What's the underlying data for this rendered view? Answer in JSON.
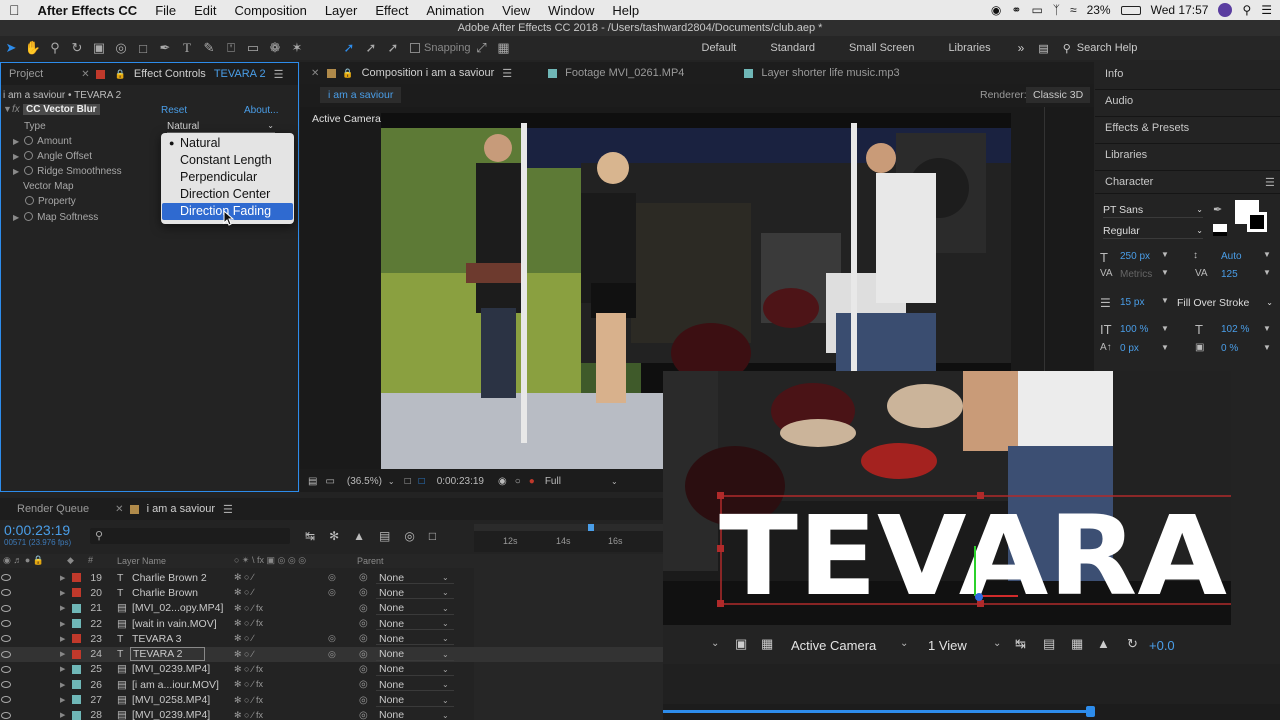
{
  "menubar": {
    "items": [
      "After Effects CC",
      "File",
      "Edit",
      "Composition",
      "Layer",
      "Effect",
      "Animation",
      "View",
      "Window",
      "Help"
    ],
    "battery": "23%",
    "clock": "Wed 17:57"
  },
  "titlebar": {
    "title": "Adobe After Effects CC 2018 - /Users/tashward2804/Documents/club.aep *"
  },
  "toolbar": {
    "snapping": "Snapping",
    "workspaces": [
      "Default",
      "Standard",
      "Small Screen",
      "Libraries"
    ],
    "search": "Search Help"
  },
  "effect_panel": {
    "tab_project": "Project",
    "tab_effect_prefix": "Effect Controls ",
    "tab_effect_layer": "TEVARA 2",
    "breadcrumb": "i am a saviour • TEVARA 2",
    "effect_name": "CC Vector Blur",
    "reset": "Reset",
    "about": "About...",
    "type_label": "Type",
    "type_value": "Natural",
    "props": [
      "Amount",
      "Angle Offset",
      "Ridge Smoothness"
    ],
    "vector_map": "Vector Map",
    "property": "Property",
    "map_softness": "Map Softness",
    "type_options": [
      "Natural",
      "Constant Length",
      "Perpendicular",
      "Direction Center",
      "Direction Fading"
    ],
    "highlighted_option": "Direction Fading"
  },
  "comp_panel": {
    "tabs": [
      "Composition i am a saviour",
      "Footage MVI_0261.MP4",
      "Layer shorter life music.mp3"
    ],
    "comp_button": "i am a saviour",
    "renderer_label": "Renderer:",
    "renderer_value": "Classic 3D",
    "active_camera": "Active Camera",
    "zoom": "(36.5%)",
    "timecode": "0:00:23:19",
    "resolution": "Full"
  },
  "right_panel": {
    "sections": [
      "Info",
      "Audio",
      "Effects & Presets",
      "Libraries",
      "Character"
    ],
    "font": "PT Sans",
    "style": "Regular",
    "font_size": "250 px",
    "leading": "Auto",
    "kerning": "Metrics",
    "tracking": "125",
    "stroke_width": "15 px",
    "stroke_type": "Fill Over Stroke",
    "vscale": "100 %",
    "hscale": "102 %",
    "baseline": "0 px",
    "tsume": "0 %"
  },
  "timeline": {
    "tab_render": "Render Queue",
    "tab_comp": "i am a saviour",
    "timecode": "0:00:23:19",
    "frames": "00571 (23.976 fps)",
    "ruler": [
      "12s",
      "14s",
      "16s"
    ],
    "col_layer_name": "Layer Name",
    "col_parent": "Parent",
    "layers": [
      {
        "num": "19",
        "type": "T",
        "name": "Charlie Brown 2",
        "parent": "None",
        "color": "#c0392b"
      },
      {
        "num": "20",
        "type": "T",
        "name": "Charlie Brown",
        "parent": "None",
        "color": "#c0392b"
      },
      {
        "num": "21",
        "type": "F",
        "name": "[MVI_02...opy.MP4]",
        "parent": "None",
        "color": "#6fb7b7"
      },
      {
        "num": "22",
        "type": "F",
        "name": "[wait in vain.MOV]",
        "parent": "None",
        "color": "#6fb7b7"
      },
      {
        "num": "23",
        "type": "T",
        "name": "TEVARA 3",
        "parent": "None",
        "color": "#c0392b"
      },
      {
        "num": "24",
        "type": "T",
        "name": "TEVARA 2",
        "parent": "None",
        "color": "#c0392b"
      },
      {
        "num": "25",
        "type": "F",
        "name": "[MVI_0239.MP4]",
        "parent": "None",
        "color": "#6fb7b7"
      },
      {
        "num": "26",
        "type": "F",
        "name": "[i am a...iour.MOV]",
        "parent": "None",
        "color": "#6fb7b7"
      },
      {
        "num": "27",
        "type": "F",
        "name": "[MVI_0258.MP4]",
        "parent": "None",
        "color": "#6fb7b7"
      },
      {
        "num": "28",
        "type": "F",
        "name": "[MVI_0239.MP4]",
        "parent": "None",
        "color": "#6fb7b7"
      }
    ]
  },
  "overlay": {
    "title_text": "TEVARA",
    "camera": "Active Camera",
    "views": "1 View",
    "exposure": "+0.0"
  },
  "colors": {
    "accent": "#2d8ceb",
    "menu_highlight": "#2f6ad0",
    "timecode_blue": "#4a9ee8"
  }
}
